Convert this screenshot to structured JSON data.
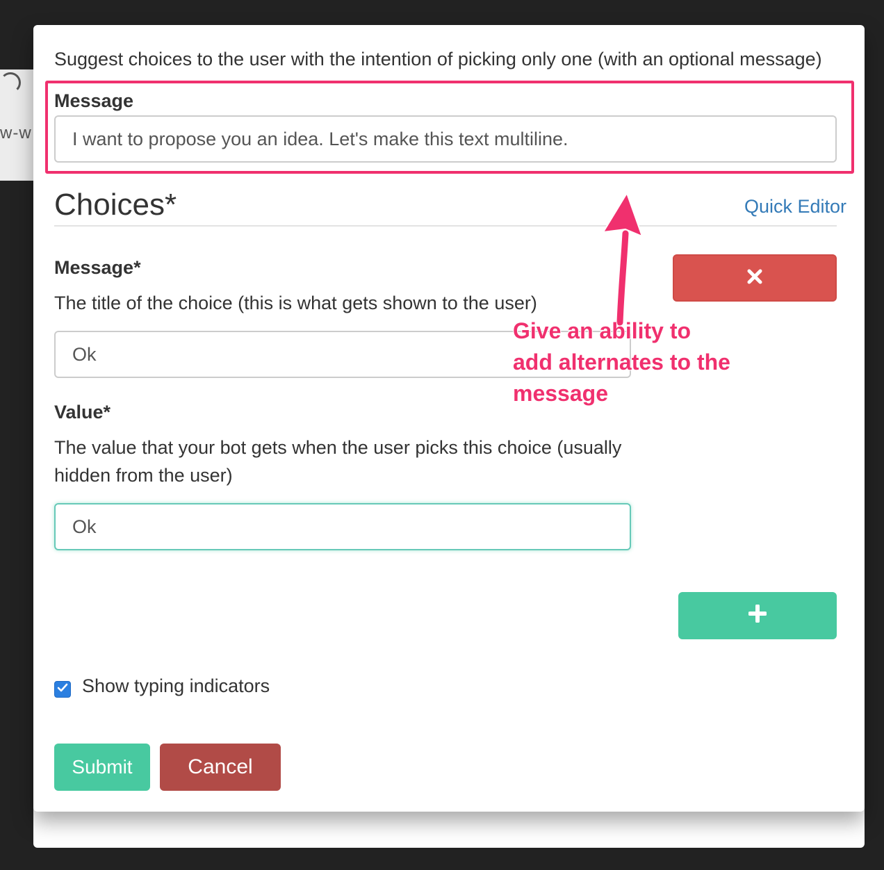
{
  "dialog": {
    "description": "Suggest choices to the user with the intention of picking only one (with an optional message)",
    "message_label": "Message",
    "message_value": "I want to propose you an idea. Let's make this text multiline."
  },
  "choices": {
    "title": "Choices*",
    "quick_editor_label": "Quick Editor",
    "items": [
      {
        "message_label": "Message*",
        "message_help": "The title of the choice (this is what gets shown to the user)",
        "message_value": "Ok",
        "value_label": "Value*",
        "value_help": "The value that your bot gets when the user picks this choice (usually hidden from the user)",
        "value_value": "Ok"
      }
    ]
  },
  "typing": {
    "checked": true,
    "label": "Show typing indicators"
  },
  "actions": {
    "submit_label": "Submit",
    "cancel_label": "Cancel"
  },
  "annotation": {
    "text": "Give an ability to add alternates to the message",
    "color": "#f0306e"
  },
  "background": {
    "fragment": "w-w"
  },
  "icons": {
    "remove": "close-icon",
    "add": "plus-icon",
    "check": "checkmark-icon"
  },
  "colors": {
    "danger": "#d9534f",
    "success": "#48c9a0",
    "cancel": "#b14b47",
    "link": "#337ab7",
    "checkbox": "#2b7fe0"
  }
}
